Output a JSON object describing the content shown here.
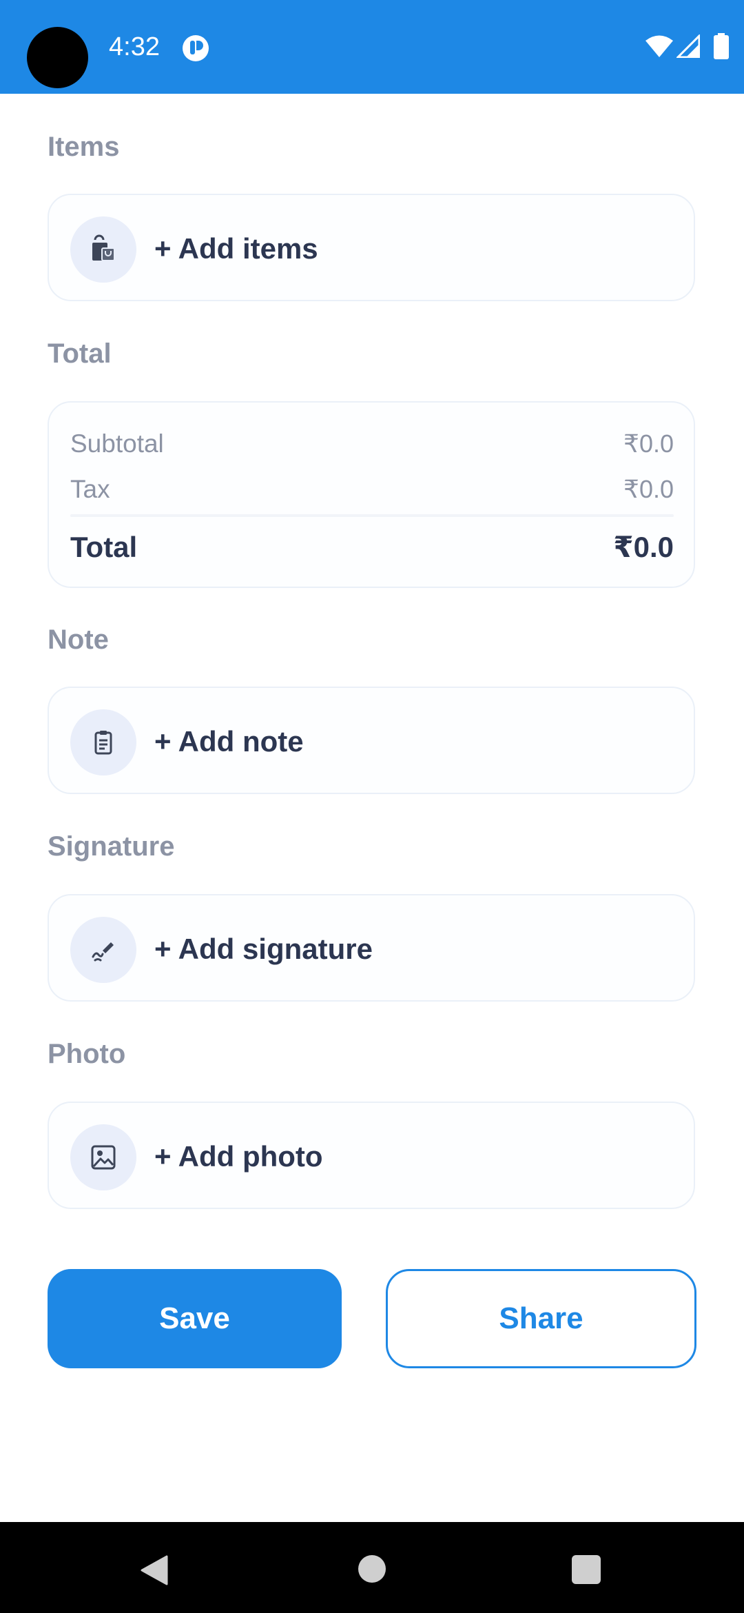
{
  "status_bar": {
    "time": "4:32",
    "color": "#1e88e5"
  },
  "sections": {
    "items": {
      "heading": "Items",
      "action_label": "+ Add items",
      "icon": "shopping-bag-icon"
    },
    "total": {
      "heading": "Total"
    },
    "note": {
      "heading": "Note",
      "action_label": "+ Add note",
      "icon": "clipboard-icon"
    },
    "signature": {
      "heading": "Signature",
      "action_label": "+ Add signature",
      "icon": "signature-pen-icon"
    },
    "photo": {
      "heading": "Photo",
      "action_label": "+ Add photo",
      "icon": "image-icon"
    }
  },
  "totals": {
    "subtotal_label": "Subtotal",
    "subtotal_value": "₹0.0",
    "tax_label": "Tax",
    "tax_value": "₹0.0",
    "total_label": "Total",
    "total_value": "₹0.0"
  },
  "buttons": {
    "save_label": "Save",
    "share_label": "Share"
  },
  "colors": {
    "accent": "#1e88e5",
    "heading_text": "#8c93a4",
    "primary_text": "#2c3651",
    "icon_bg": "#e9eefa"
  }
}
